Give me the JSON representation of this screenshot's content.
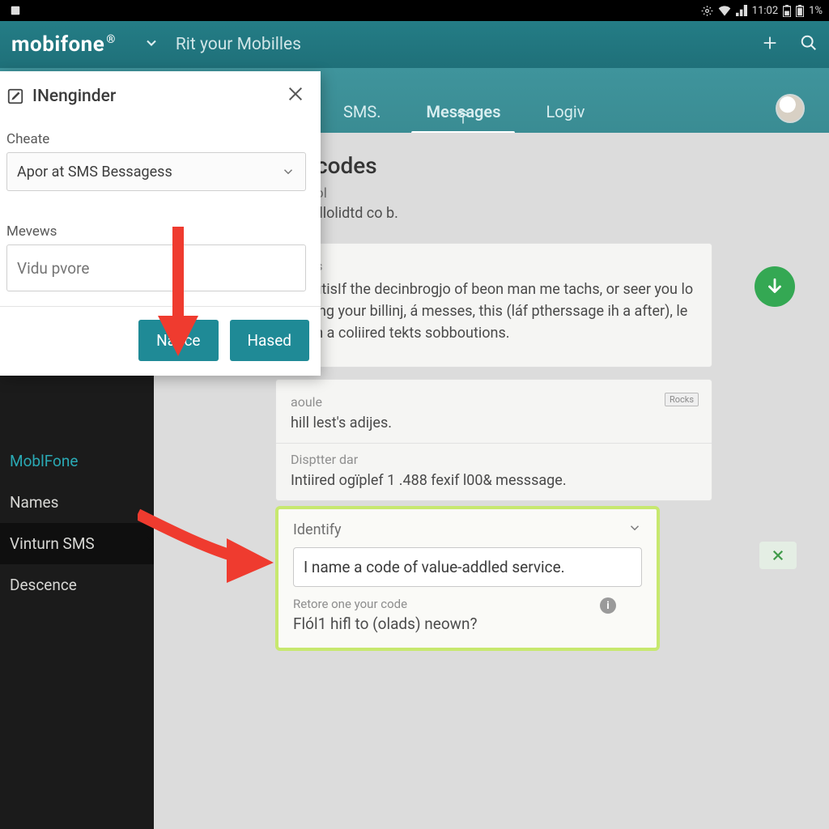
{
  "statusbar": {
    "time": "11:02",
    "battery_suffix": "1%"
  },
  "header": {
    "brand": "mobifone",
    "brand_sup": "®",
    "title": "Rit your Mobilles"
  },
  "tabs": {
    "sms": "SMS.",
    "messages": "Messages",
    "logiv": "Logiv"
  },
  "sidebar": {
    "items": [
      {
        "label": "MoblFone"
      },
      {
        "label": "Names"
      },
      {
        "label": "Vinturn SMS"
      },
      {
        "label": "Descence"
      }
    ]
  },
  "content": {
    "page_title": "codes",
    "sub1": "ol",
    "sub2": "illolidtd co b.",
    "card1": {
      "muted": "ames",
      "paragraph": "loclutisIf the decinbrogjo of beon man me tachs, or seer you lo oleang your billinj, á messes, this (láf ptherssage ih a after), le to an a coliired tekts sobboutions."
    },
    "card2": {
      "muted": "aoule",
      "line1": "hill lest's adijes.",
      "muted2": "Disptter dar",
      "line2": "Intiired ogïplef 1 .488 fexif l00& messsage.",
      "badge": "Rocks"
    },
    "identify": {
      "header": "Identify",
      "input_value": "I name a code of value-addled service.",
      "hint_label": "Retore one your code",
      "hint_text": "Flól1 hifl to (olads) neown?"
    }
  },
  "modal": {
    "title": "INenginder",
    "label_create": "Cheate",
    "select_value": "Apor at SMS Bessagess",
    "label_mevews": "Mevews",
    "text_placeholder": "Vidu pvore",
    "btn_primary": "Nance",
    "btn_secondary": "Hased"
  }
}
